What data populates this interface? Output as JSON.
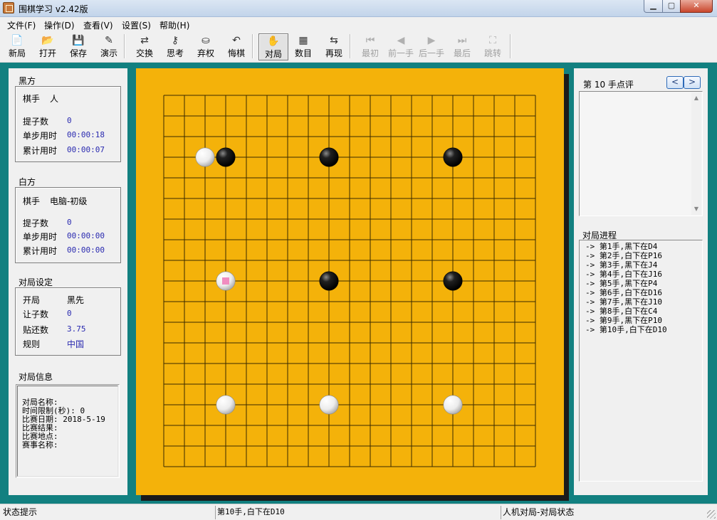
{
  "window": {
    "title": "围棋学习 v2.42版"
  },
  "menu": [
    "文件(F)",
    "操作(D)",
    "查看(V)",
    "设置(S)",
    "帮助(H)"
  ],
  "toolbar": [
    {
      "label": "新局",
      "icon": "new-game-icon",
      "glyph": "📄",
      "enabled": true
    },
    {
      "label": "打开",
      "icon": "open-folder-icon",
      "glyph": "📂",
      "enabled": true
    },
    {
      "label": "保存",
      "icon": "save-icon",
      "glyph": "💾",
      "enabled": true
    },
    {
      "label": "演示",
      "icon": "demo-icon",
      "glyph": "✎",
      "enabled": true
    },
    {
      "label": "交换",
      "icon": "swap-icon",
      "glyph": "⇄",
      "enabled": true
    },
    {
      "label": "思考",
      "icon": "think-icon",
      "glyph": "⚷",
      "enabled": true
    },
    {
      "label": "弃权",
      "icon": "pass-icon",
      "glyph": "⛀",
      "enabled": true
    },
    {
      "label": "悔棋",
      "icon": "undo-icon",
      "glyph": "↶",
      "enabled": true
    },
    {
      "label": "对局",
      "icon": "play-hand-icon",
      "glyph": "✋",
      "enabled": true,
      "active": true
    },
    {
      "label": "数目",
      "icon": "count-icon",
      "glyph": "▦",
      "enabled": true
    },
    {
      "label": "再现",
      "icon": "replay-icon",
      "glyph": "⇆",
      "enabled": true
    },
    {
      "label": "最初",
      "icon": "first-icon",
      "glyph": "⏮",
      "enabled": false
    },
    {
      "label": "前一手",
      "icon": "prev-icon",
      "glyph": "◀",
      "enabled": false
    },
    {
      "label": "后一手",
      "icon": "next-icon",
      "glyph": "▶",
      "enabled": false
    },
    {
      "label": "最后",
      "icon": "last-icon",
      "glyph": "⏭",
      "enabled": false
    },
    {
      "label": "跳转",
      "icon": "jump-binoculars-icon",
      "glyph": "⛶",
      "enabled": false
    }
  ],
  "black": {
    "section": "黑方",
    "player_label": "棋手",
    "player": "人",
    "captures_label": "提子数",
    "captures": "0",
    "step_time_label": "单步用时",
    "step_time": "00:00:18",
    "total_time_label": "累计用时",
    "total_time": "00:00:07"
  },
  "white": {
    "section": "白方",
    "player_label": "棋手",
    "player": "电脑-初级",
    "captures_label": "提子数",
    "captures": "0",
    "step_time_label": "单步用时",
    "step_time": "00:00:00",
    "total_time_label": "累计用时",
    "total_time": "00:00:00"
  },
  "settings": {
    "section": "对局设定",
    "opening_label": "开局",
    "opening": "黑先",
    "handicap_label": "让子数",
    "handicap": "0",
    "komi_label": "贴还数",
    "komi": "3.75",
    "rules_label": "规则",
    "rules": "中国"
  },
  "game_info": {
    "section": "对局信息",
    "lines": [
      "对局名称:",
      "时间限制(秒): 0",
      "比赛日期: 2018-5-19",
      "比赛结果:",
      "比赛地点:",
      "赛事名称:"
    ]
  },
  "board": {
    "size": 19,
    "colors": {
      "board": "#f4b20a",
      "line": "#3a2a00",
      "frame": "#128080",
      "last_move_marker": "#f08cc0"
    },
    "stones": [
      {
        "color": "black",
        "col": "D",
        "row": 16
      },
      {
        "color": "black",
        "col": "J",
        "row": 16
      },
      {
        "color": "black",
        "col": "P",
        "row": 16
      },
      {
        "color": "black",
        "col": "J",
        "row": 10
      },
      {
        "color": "black",
        "col": "P",
        "row": 10
      },
      {
        "color": "white",
        "col": "C",
        "row": 16
      },
      {
        "color": "white",
        "col": "D",
        "row": 10,
        "last": true
      },
      {
        "color": "white",
        "col": "D",
        "row": 4
      },
      {
        "color": "white",
        "col": "J",
        "row": 4
      },
      {
        "color": "white",
        "col": "P",
        "row": 4
      }
    ]
  },
  "comment": {
    "title": "第  10  手点评",
    "prev": "<",
    "next": ">"
  },
  "progress": {
    "title": "对局进程",
    "moves": [
      "-> 第1手,黑下在D4",
      "-> 第2手,白下在P16",
      "-> 第3手,黑下在J4",
      "-> 第4手,白下在J16",
      "-> 第5手,黑下在P4",
      "-> 第6手,白下在D16",
      "-> 第7手,黑下在J10",
      "-> 第8手,白下在C4",
      "-> 第9手,黑下在P10",
      "-> 第10手,白下在D10"
    ]
  },
  "status": {
    "hint": "状态提示",
    "last_move": "第10手,白下在D10",
    "mode": "人机对局-对局状态"
  }
}
